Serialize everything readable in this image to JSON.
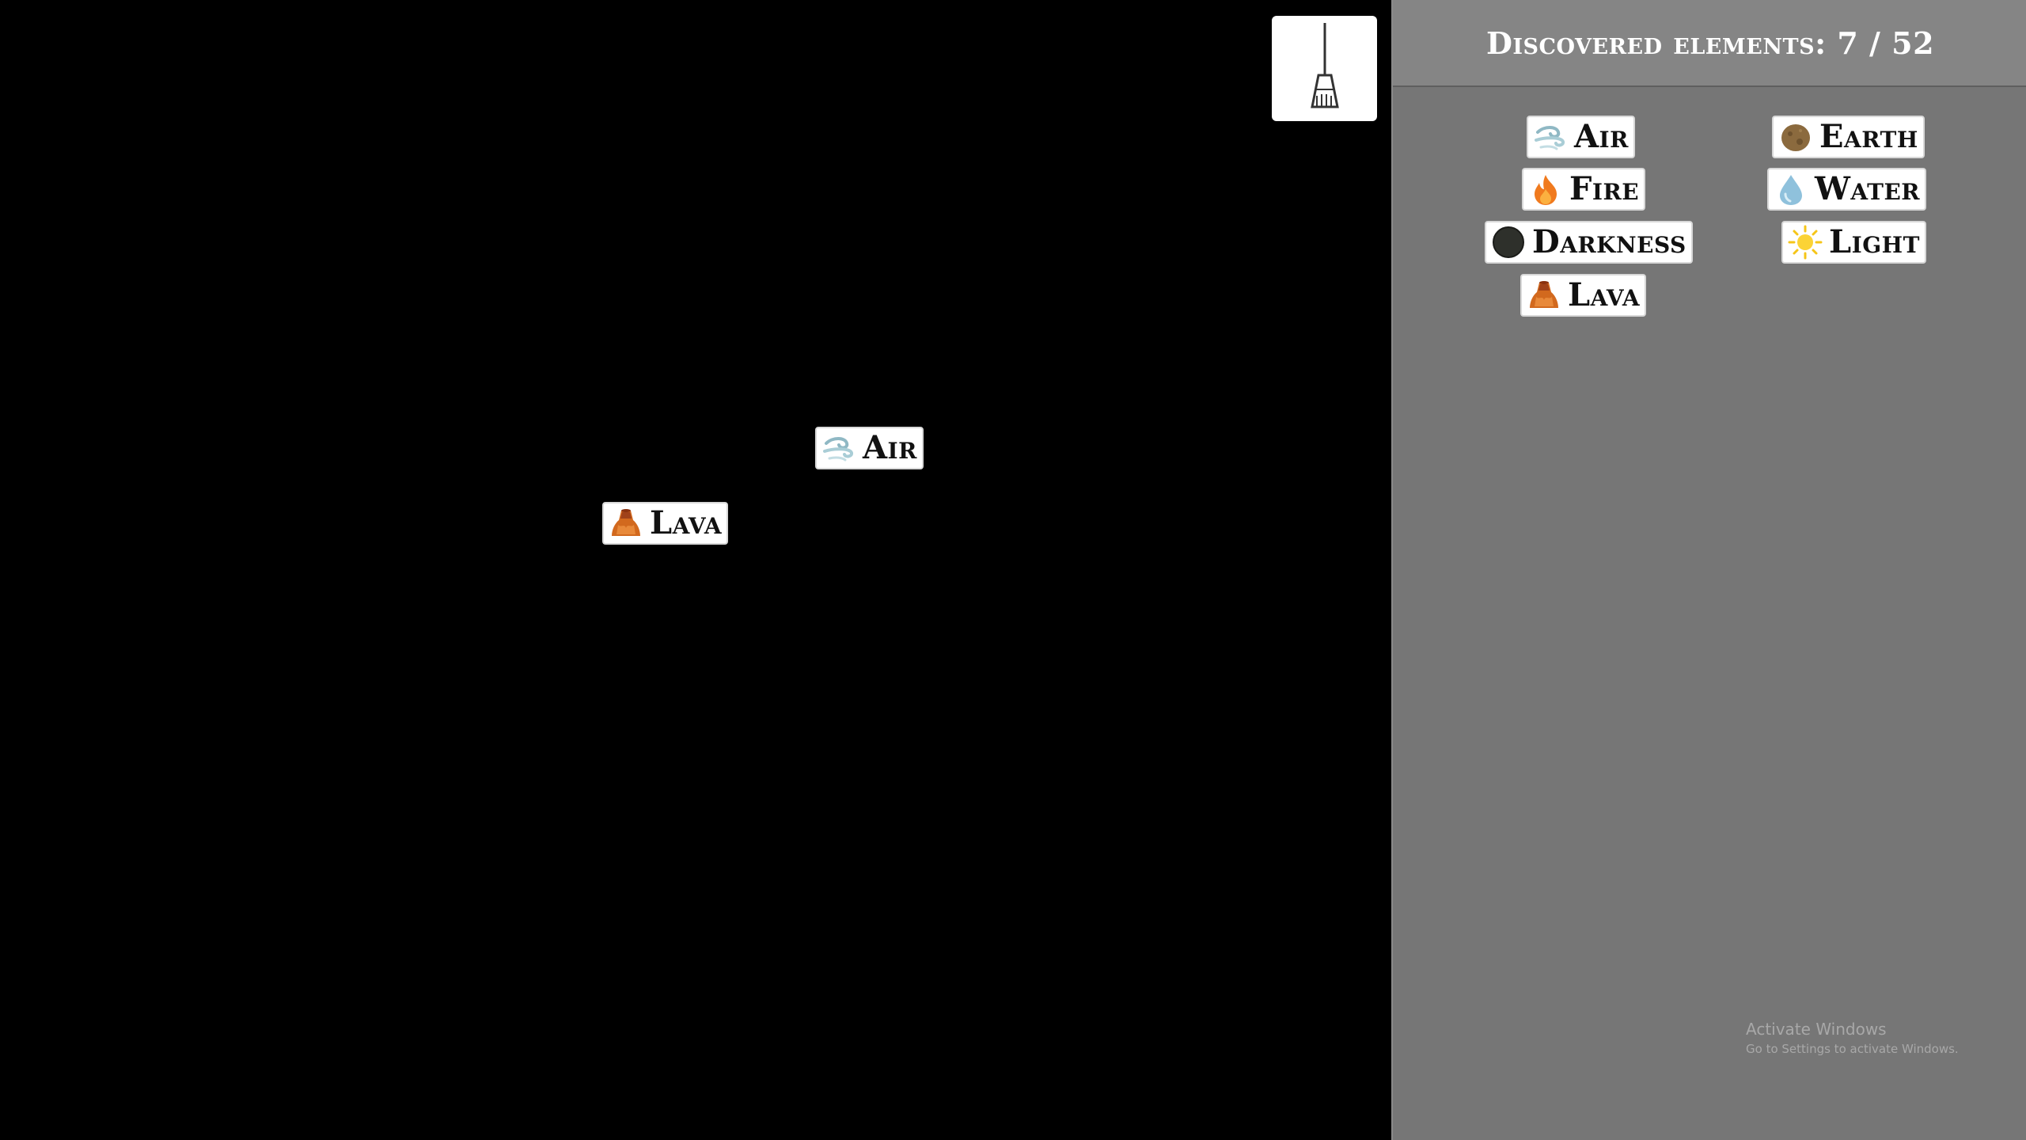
{
  "sidebar": {
    "title": "Discovered elements: 7 / 52",
    "elements": [
      {
        "label": "Air",
        "icon": "air-icon"
      },
      {
        "label": "Earth",
        "icon": "earth-icon"
      },
      {
        "label": "Fire",
        "icon": "fire-icon"
      },
      {
        "label": "Water",
        "icon": "water-icon"
      },
      {
        "label": "Darkness",
        "icon": "darkness-icon"
      },
      {
        "label": "Light",
        "icon": "light-icon"
      },
      {
        "label": "Lava",
        "icon": "lava-icon"
      }
    ]
  },
  "canvas": {
    "elements": [
      {
        "label": "Air",
        "icon": "air-icon"
      },
      {
        "label": "Lava",
        "icon": "lava-icon"
      }
    ]
  },
  "clear_button": {
    "icon": "broom-icon"
  },
  "watermark": {
    "title": "Activate Windows",
    "subtitle": "Go to Settings to activate Windows."
  },
  "colors": {
    "canvas_bg": "#000000",
    "sidebar_bg": "#767676",
    "header_bg": "#858585",
    "chip_bg": "#ffffff"
  }
}
